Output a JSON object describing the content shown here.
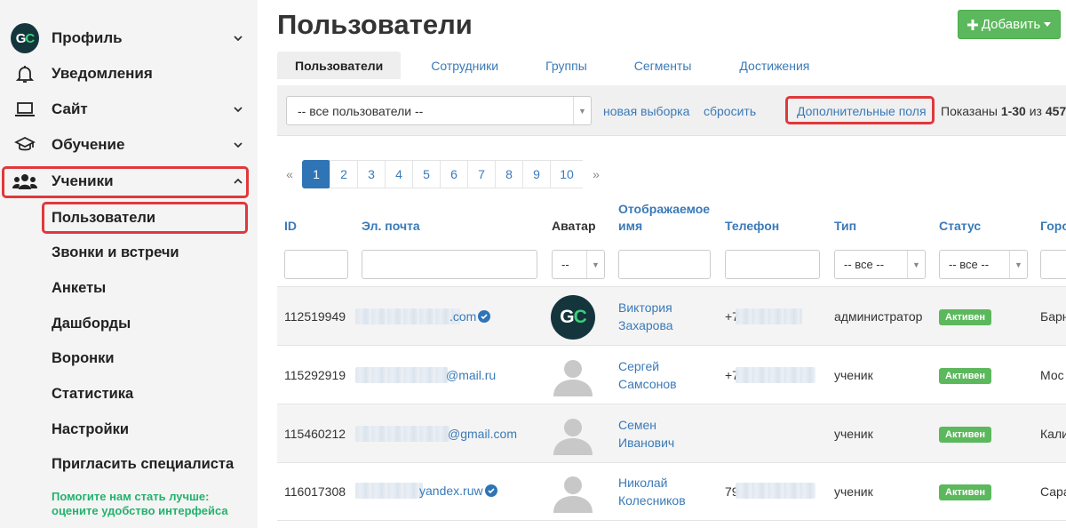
{
  "sidebar": {
    "items": [
      {
        "label": "Профиль",
        "icon": "gc-logo-icon"
      },
      {
        "label": "Уведомления",
        "icon": "bell-icon"
      },
      {
        "label": "Сайт",
        "icon": "laptop-icon"
      },
      {
        "label": "Обучение",
        "icon": "graduation-cap-icon"
      },
      {
        "label": "Ученики",
        "icon": "users-icon"
      }
    ],
    "logo_text_g": "G",
    "logo_text_c": "C",
    "subitems": [
      {
        "label": "Пользователи"
      },
      {
        "label": "Звонки и встречи"
      },
      {
        "label": "Анкеты"
      },
      {
        "label": "Дашборды"
      },
      {
        "label": "Воронки"
      },
      {
        "label": "Статистика"
      },
      {
        "label": "Настройки"
      },
      {
        "label": "Пригласить специалиста"
      }
    ],
    "feedback_line1": "Помогите нам стать лучше:",
    "feedback_line2": "оцените удобство интерфейса"
  },
  "header": {
    "title": "Пользователи",
    "add_button": "Добавить"
  },
  "tabs": [
    {
      "label": "Пользователи",
      "active": true
    },
    {
      "label": "Сотрудники",
      "active": false
    },
    {
      "label": "Группы",
      "active": false
    },
    {
      "label": "Сегменты",
      "active": false
    },
    {
      "label": "Достижения",
      "active": false
    }
  ],
  "filter": {
    "select_value": "-- все пользователи --",
    "new_selection": "новая выборка",
    "reset": "сбросить",
    "extra_fields": "Дополнительные поля",
    "shown_prefix": "Показаны ",
    "shown_range": "1-30",
    "shown_middle": " из ",
    "shown_total": "457"
  },
  "pagination": {
    "prev": "«",
    "pages": [
      "1",
      "2",
      "3",
      "4",
      "5",
      "6",
      "7",
      "8",
      "9",
      "10"
    ],
    "next": "»",
    "active": "1"
  },
  "table": {
    "headers": {
      "id": "ID",
      "email": "Эл. почта",
      "avatar": "Аватар",
      "display_name_1": "Отображаемое",
      "display_name_2": "имя",
      "phone": "Телефон",
      "type": "Тип",
      "status": "Статус",
      "city": "Горо"
    },
    "filters": {
      "avatar_select": "--",
      "type_select": "-- все --",
      "status_select": "-- все --"
    },
    "rows": [
      {
        "id": "112519949",
        "email_visible": ".com",
        "verified": true,
        "avatar": "gc",
        "name_1": "Виктория",
        "name_2": "Захарова",
        "phone_visible": "+7",
        "type": "администратор",
        "status": "Активен",
        "city": "Барн"
      },
      {
        "id": "115292919",
        "email_visible": "@mail.ru",
        "verified": false,
        "avatar": "placeholder",
        "name_1": "Сергей",
        "name_2": "Самсонов",
        "phone_visible": "+7",
        "type": "ученик",
        "status": "Активен",
        "city": "Мос"
      },
      {
        "id": "115460212",
        "email_visible": "@gmail.com",
        "verified": false,
        "avatar": "placeholder",
        "name_1": "Семен",
        "name_2": "Иванович",
        "phone_visible": "",
        "type": "ученик",
        "status": "Активен",
        "city": "Кали"
      },
      {
        "id": "116017308",
        "email_visible": "yandex.ruw",
        "verified": true,
        "avatar": "placeholder",
        "name_1": "Николай",
        "name_2": "Колесников",
        "phone_visible": "79",
        "type": "ученик",
        "status": "Активен",
        "city": "Сара"
      }
    ]
  },
  "colors": {
    "accent_blue": "#3a7ab8",
    "add_green": "#5cb85c",
    "highlight_red": "#e0383b",
    "feedback_green": "#23b26d",
    "logo_dark": "#15353d"
  }
}
